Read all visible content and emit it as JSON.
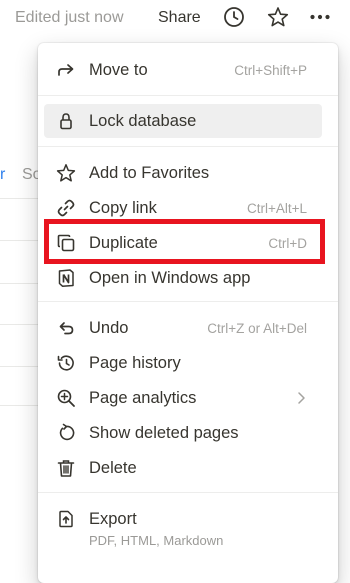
{
  "topbar": {
    "edited_text": "Edited just now",
    "share_label": "Share",
    "icons": [
      "clock-icon",
      "star-icon",
      "more-icon"
    ]
  },
  "background": {
    "link_fragment": "r",
    "sort_fragment": "So"
  },
  "menu": {
    "items": [
      {
        "label": "Move to",
        "shortcut": "Ctrl+Shift+P",
        "icon": "move-arrow-icon"
      },
      {
        "label": "Lock database",
        "shortcut": "",
        "icon": "lock-icon"
      },
      {
        "label": "Add to Favorites",
        "shortcut": "",
        "icon": "star-icon"
      },
      {
        "label": "Copy link",
        "shortcut": "Ctrl+Alt+L",
        "icon": "link-icon"
      },
      {
        "label": "Duplicate",
        "shortcut": "Ctrl+D",
        "icon": "duplicate-icon"
      },
      {
        "label": "Open in Windows app",
        "shortcut": "",
        "icon": "notion-app-icon"
      },
      {
        "label": "Undo",
        "shortcut": "Ctrl+Z or Alt+Del",
        "icon": "undo-icon"
      },
      {
        "label": "Page history",
        "shortcut": "",
        "icon": "history-icon"
      },
      {
        "label": "Page analytics",
        "shortcut": "",
        "icon": "analytics-icon"
      },
      {
        "label": "Show deleted pages",
        "shortcut": "",
        "icon": "restore-icon"
      },
      {
        "label": "Delete",
        "shortcut": "",
        "icon": "trash-icon"
      },
      {
        "label": "Export",
        "shortcut": "",
        "icon": "export-icon",
        "sublabel": "PDF, HTML, Markdown"
      }
    ]
  },
  "colors": {
    "text": "#37352f",
    "muted": "#9b9a97",
    "highlight": "#efefef",
    "annotation": "#e8141f"
  }
}
